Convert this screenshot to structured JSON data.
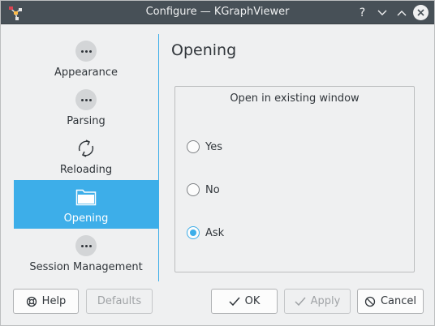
{
  "window": {
    "title": "Configure — KGraphViewer"
  },
  "titlebar_buttons": {
    "help": "?",
    "minimize": "﹀",
    "maximize": "︿"
  },
  "sidebar": {
    "items": [
      {
        "label": "Appearance",
        "icon": "more-dots-icon",
        "active": false
      },
      {
        "label": "Parsing",
        "icon": "more-dots-icon",
        "active": false
      },
      {
        "label": "Reloading",
        "icon": "reload-icon",
        "active": false
      },
      {
        "label": "Opening",
        "icon": "folder-icon",
        "active": true
      },
      {
        "label": "Session Management",
        "icon": "more-dots-icon",
        "active": false
      }
    ]
  },
  "main": {
    "title": "Opening",
    "group_title": "Open in existing window",
    "options": [
      {
        "label": "Yes",
        "checked": false
      },
      {
        "label": "No",
        "checked": false
      },
      {
        "label": "Ask",
        "checked": true
      }
    ]
  },
  "buttons": {
    "help": "Help",
    "defaults": "Defaults",
    "ok": "OK",
    "apply": "Apply",
    "cancel": "Cancel"
  },
  "colors": {
    "accent": "#3daee9",
    "titlebar": "#475057",
    "background": "#eff0f1"
  }
}
